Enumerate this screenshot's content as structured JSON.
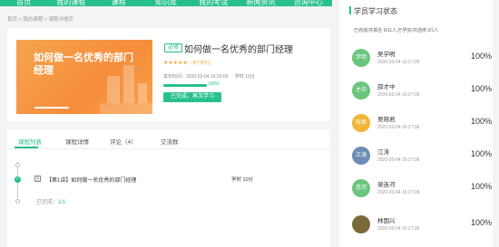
{
  "topnav": {
    "items": [
      "首页",
      "我的课程",
      "课程",
      "知识库",
      "我的考试",
      "新闻资讯",
      "咨询中心"
    ]
  },
  "breadcrumb": "首页 > 我的课程 > 课程详情页",
  "course": {
    "cover_title": "如何做一名优秀的部门经理",
    "tag": "必修",
    "title": "如何做一名优秀的部门经理",
    "stars": "★★★★★",
    "rating_count": "(4个评价)",
    "publish_time": "发布时间：2020-03-04 16:20:09",
    "study_time": "学时 10分",
    "progress_percent": 100,
    "progress_text": "100%",
    "relearn_label": "已完成，再次学习"
  },
  "tabs": [
    "课程列表",
    "课程详情",
    "评论（4）",
    "交流群"
  ],
  "lessons": [
    {
      "icon": "目",
      "title": "【第1讲】如何做一名优秀的部门经理",
      "time": "学时 10分"
    }
  ],
  "completed": {
    "label": "已完成：",
    "value": "1/1"
  },
  "right_panel": {
    "title": "学员学习状态",
    "summary": "已完成/共报名 9/11人,已学完/共选修 0/1人",
    "students": [
      {
        "avatar_text": "学明",
        "name": "吴学明",
        "date": "2020-03-04 16:27:06",
        "percent": "100%",
        "color": "#6cc57e"
      },
      {
        "avatar_text": "才中",
        "name": "邵才中",
        "date": "2020-03-04 16:27:06",
        "percent": "100%",
        "color": "#6cc57e"
      },
      {
        "avatar_text": "晓君",
        "name": "吴晓君",
        "date": "2020-03-04 16:27:06",
        "percent": "100%",
        "color": "#f2b535"
      },
      {
        "avatar_text": "江涛",
        "name": "江涛",
        "date": "2020-03-04 16:27:06",
        "percent": "100%",
        "color": "#6d8db6"
      },
      {
        "avatar_text": "连河",
        "name": "梁连河",
        "date": "2020-03-04 16:27:06",
        "percent": "100%",
        "color": "#6cc57e"
      },
      {
        "avatar_text": "",
        "name": "林国兴",
        "date": "2020-03-04 16:27:06",
        "percent": "100%",
        "color": "#7a6a3a"
      }
    ]
  },
  "colors": {
    "accent": "#27c08c",
    "star": "#f7a33b",
    "cover": "#f68d3c"
  }
}
